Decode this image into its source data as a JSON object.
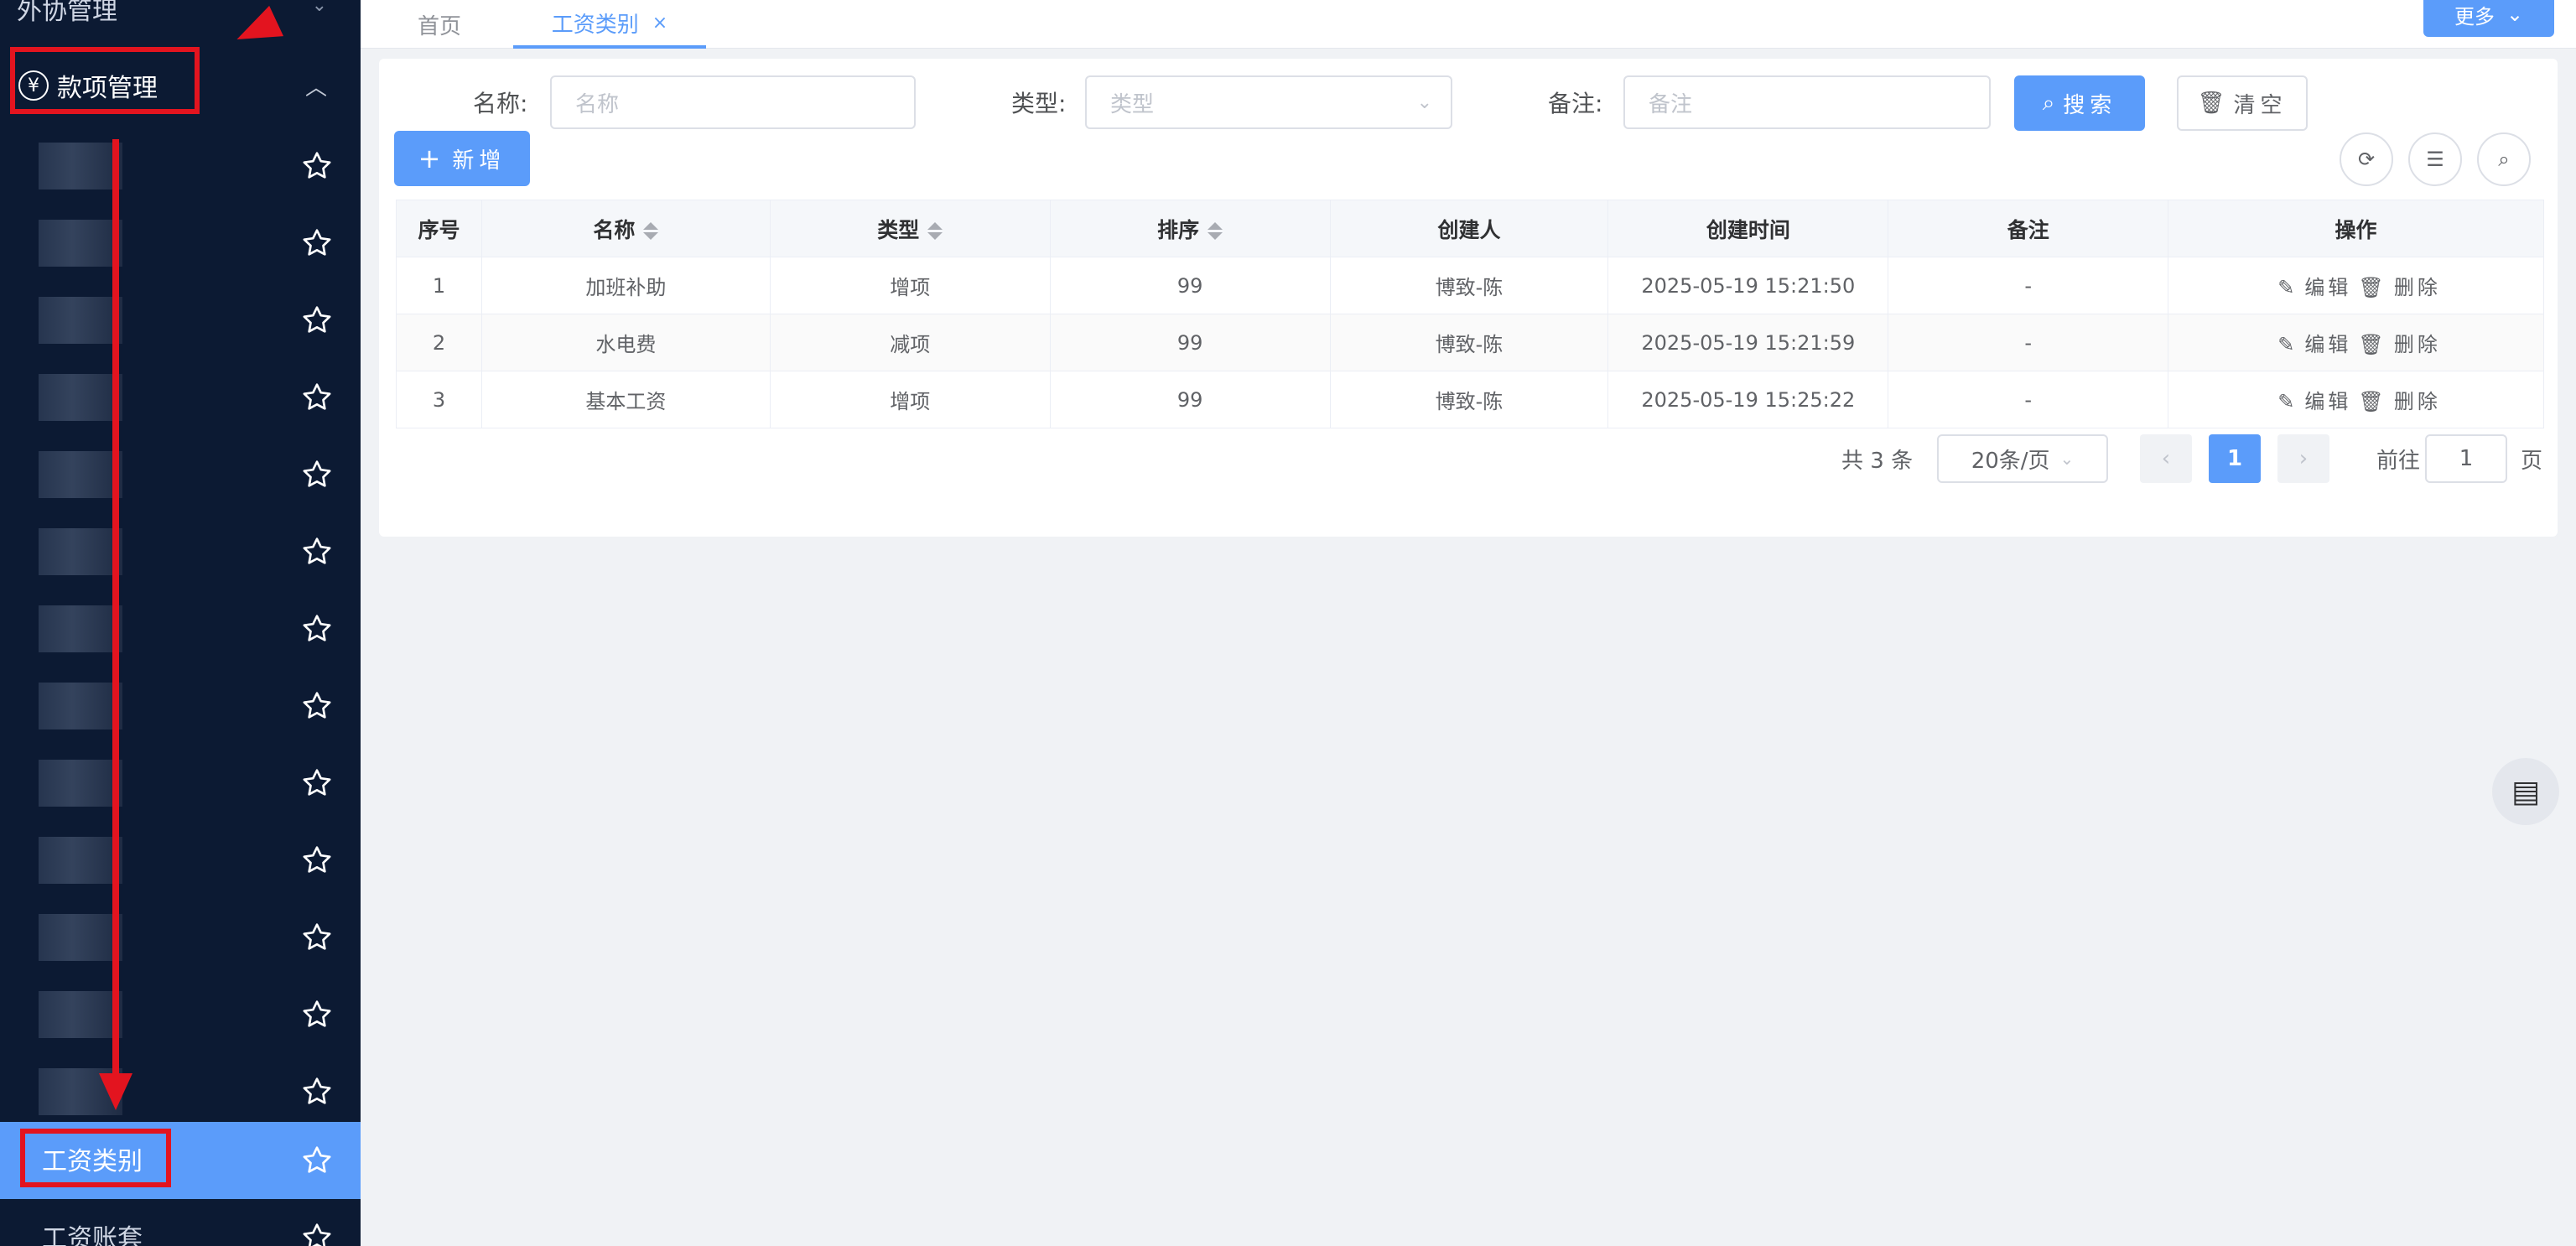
{
  "sidebar": {
    "top_item": "外协管理",
    "group_label": "款项管理",
    "active_item": "工资类别",
    "next_item": "工资账套"
  },
  "tabs": {
    "home": "首页",
    "active": "工资类别",
    "close": "×",
    "more": "更多"
  },
  "filters": {
    "name_label": "名称:",
    "name_placeholder": "名称",
    "type_label": "类型:",
    "type_placeholder": "类型",
    "remark_label": "备注:",
    "remark_placeholder": "备注",
    "search_btn": "搜索",
    "clear_btn": "清空"
  },
  "toolbar": {
    "add_btn": "新增"
  },
  "table": {
    "headers": [
      "序号",
      "名称",
      "类型",
      "排序",
      "创建人",
      "创建时间",
      "备注",
      "操作"
    ],
    "rows": [
      [
        "1",
        "加班补助",
        "增项",
        "99",
        "博致-陈",
        "2025-05-19 15:21:50",
        "-"
      ],
      [
        "2",
        "水电费",
        "减项",
        "99",
        "博致-陈",
        "2025-05-19 15:21:59",
        "-"
      ],
      [
        "3",
        "基本工资",
        "增项",
        "99",
        "博致-陈",
        "2025-05-19 15:25:22",
        "-"
      ]
    ],
    "edit_label": "编辑",
    "delete_label": "删除"
  },
  "pagination": {
    "total": "共 3 条",
    "page_size": "20条/页",
    "current": "1",
    "goto_label": "前往",
    "goto_value": "1",
    "page_suffix": "页"
  },
  "colors": {
    "primary": "#5b9cfa",
    "sidebar_bg": "#0c1a33",
    "annotation_red": "#e3141f"
  }
}
